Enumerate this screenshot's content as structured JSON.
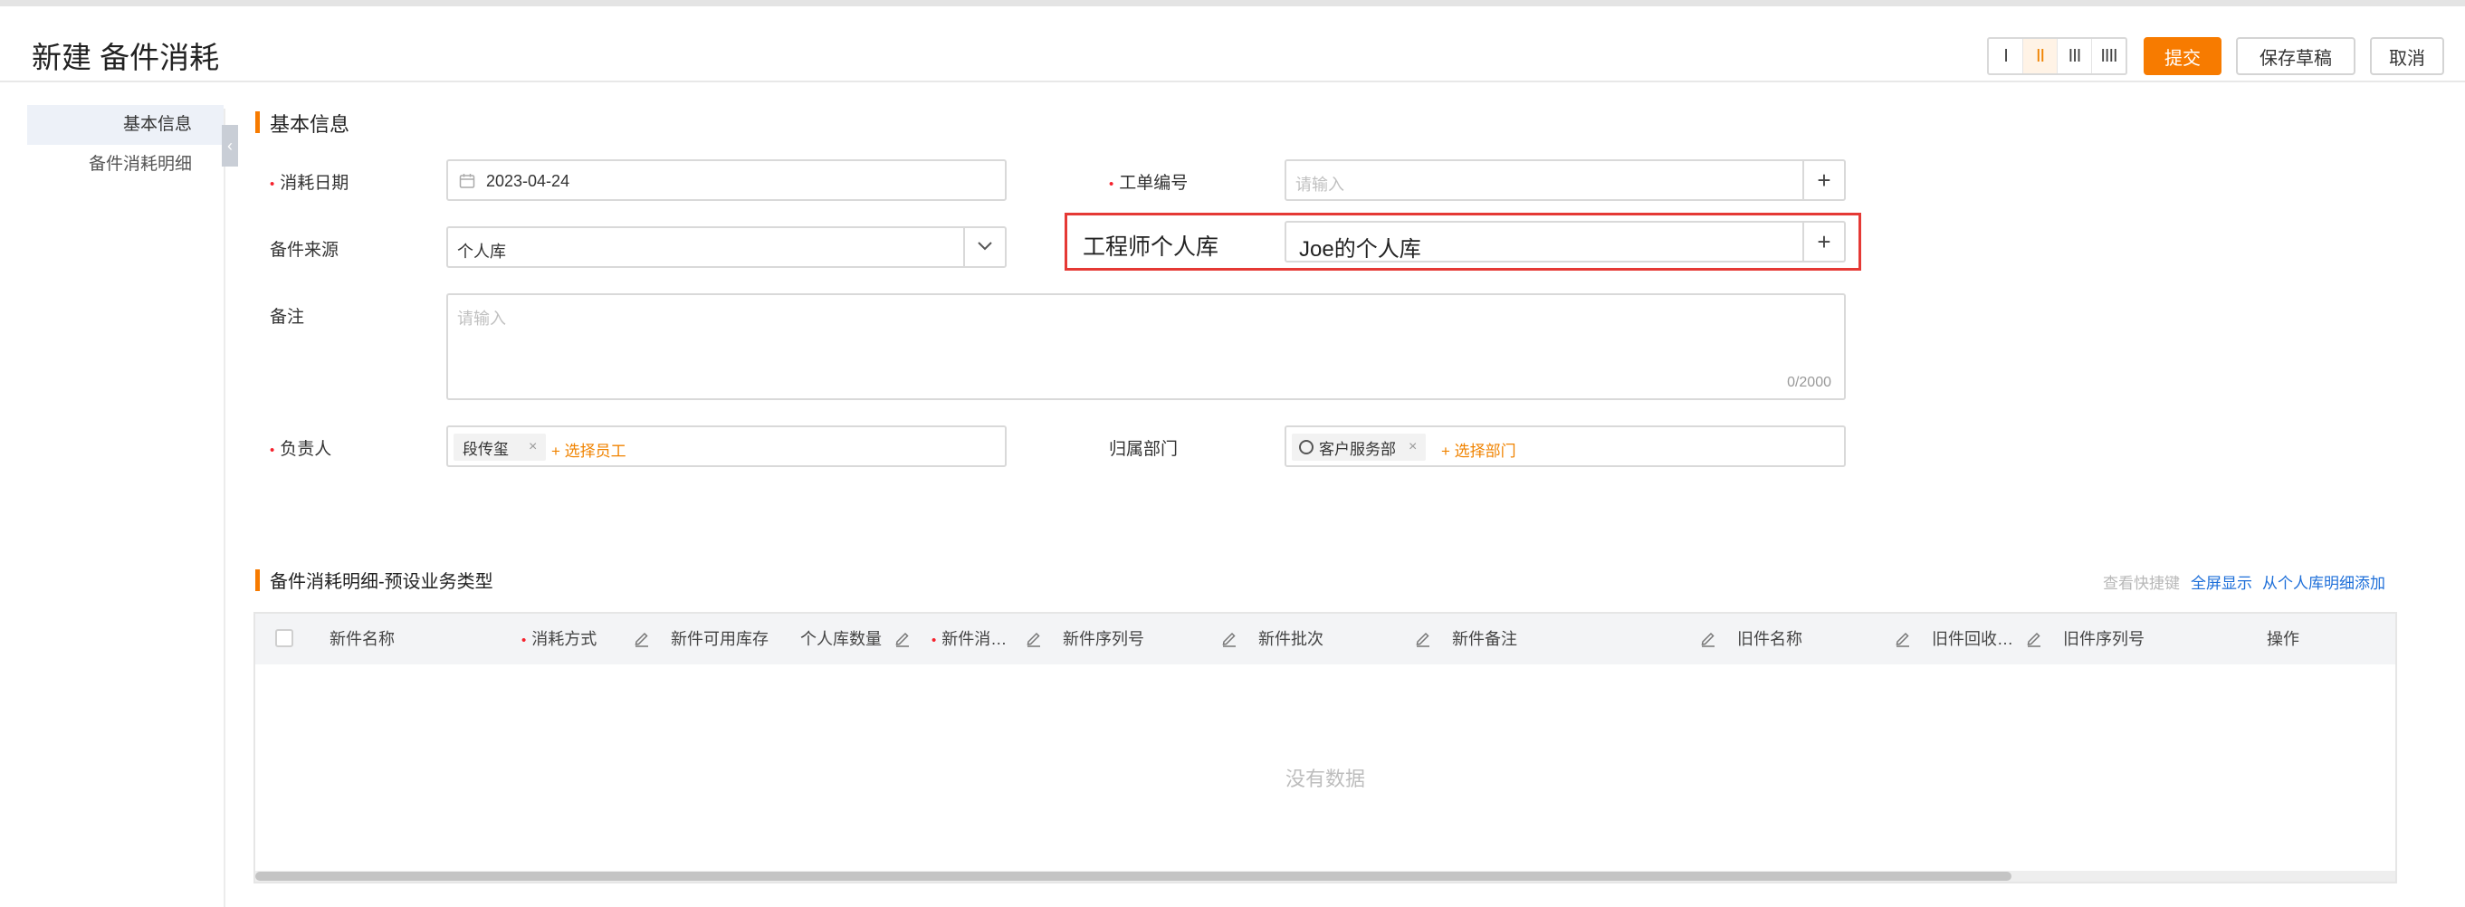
{
  "header": {
    "title": "新建 备件消耗",
    "layout_options": [
      "I",
      "II",
      "III",
      "IIII"
    ],
    "selected_layout": "II",
    "submit_label": "提交",
    "save_draft_label": "保存草稿",
    "cancel_label": "取消"
  },
  "sidebar": {
    "items": [
      {
        "label": "基本信息",
        "active": true
      },
      {
        "label": "备件消耗明细",
        "active": false
      }
    ]
  },
  "basic_info": {
    "section_title": "基本信息",
    "consume_date": {
      "label": "消耗日期",
      "required": true,
      "value": "2023-04-24"
    },
    "work_order_no": {
      "label": "工单编号",
      "required": true,
      "placeholder": "请输入"
    },
    "part_source": {
      "label": "备件来源",
      "required": false,
      "value": "个人库"
    },
    "engineer_store": {
      "label": "工程师个人库",
      "value": "Joe的个人库"
    },
    "remark": {
      "label": "备注",
      "placeholder": "请输入",
      "counter": "0/2000"
    },
    "owner": {
      "label": "负责人",
      "required": true,
      "tag": "段传玺",
      "add_label": "+ 选择员工"
    },
    "department": {
      "label": "归属部门",
      "tag": "客户服务部",
      "add_label": "+ 选择部门"
    }
  },
  "detail": {
    "section_title": "备件消耗明细-预设业务类型",
    "links": {
      "shortcut": "查看快捷键",
      "fullscreen": "全屏显示",
      "add_from_store": "从个人库明细添加"
    },
    "columns": [
      {
        "label": "新件名称",
        "required": false,
        "editable": false
      },
      {
        "label": "消耗方式",
        "required": true,
        "editable": true
      },
      {
        "label": "新件可用库存",
        "required": false,
        "editable": false
      },
      {
        "label": "个人库数量",
        "required": false,
        "editable": true
      },
      {
        "label": "新件消…",
        "required": true,
        "editable": true
      },
      {
        "label": "新件序列号",
        "required": false,
        "editable": true
      },
      {
        "label": "新件批次",
        "required": false,
        "editable": true
      },
      {
        "label": "新件备注",
        "required": false,
        "editable": true
      },
      {
        "label": "旧件名称",
        "required": false,
        "editable": true
      },
      {
        "label": "旧件回收…",
        "required": false,
        "editable": true
      },
      {
        "label": "旧件序列号",
        "required": false,
        "editable": false
      },
      {
        "label": "操作",
        "required": false,
        "editable": false
      }
    ],
    "empty_text": "没有数据"
  },
  "colors": {
    "accent": "#f77b00",
    "link": "#1e6fd9",
    "required": "#f5222d",
    "highlight": "#e53935"
  }
}
